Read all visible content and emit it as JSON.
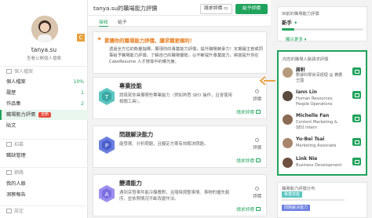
{
  "sidebar": {
    "username": "tanya.su",
    "public_view": "查看公開個人檔案",
    "sections": [
      {
        "label": "個人檔案"
      },
      {
        "label": "招募"
      },
      {
        "label": "網路"
      },
      {
        "label": "設定"
      }
    ],
    "items": [
      {
        "label": "個人檔案",
        "right": "10%"
      },
      {
        "label": "履歷",
        "right": "1"
      },
      {
        "label": "作品集",
        "right": "2"
      },
      {
        "label": "職場能力評價",
        "tag": "全新"
      },
      {
        "label": "貼文"
      },
      {
        "label": "職缺管理"
      },
      {
        "label": "我的人脈"
      },
      {
        "label": "洞察報告"
      }
    ]
  },
  "header": {
    "title": "tanya.su的職場能力評價",
    "request_btn": "請求評價",
    "self_eval_btn": "給予評價"
  },
  "tabs": [
    {
      "label": "接收"
    },
    {
      "label": "給予"
    }
  ],
  "info": {
    "heading": "累積你的職場能力評價，讓求職更順利！",
    "body": "透過全方位的衡量指標，展現你的專業能力評價，提升職場競爭力！定期讓主管或同事給予職場能力評價，了解自己的職場優勢，以不斷提升專業能力，將能提升你在 CakeResume 人才搜尋中的曝光度。"
  },
  "cards": [
    {
      "title": "專業技能",
      "desc": "請填寫你具備哪些專業能力（例如熟悉 SEO 操作，且會使用相關工具）。",
      "eval": "評價",
      "req": "請求評價"
    },
    {
      "title": "問題解決能力",
      "desc": "能發現、分析問題，且擬定方案有效解決問題。",
      "eval": "評價",
      "req": "請求評價"
    },
    {
      "title": "變通能力",
      "desc": "遇到突發事件能冷靜應對，且隨時調整事情、事物的優先順序，並依照情況不斷改變作法。",
      "eval": "評價",
      "req": "請求評價"
    }
  ],
  "level": {
    "label": "目前的職場能力評價",
    "value": "新手",
    "progress": 0.15,
    "more": "顯示更多"
  },
  "recommend": {
    "heading": "向您的職場人脈請求評價",
    "people": [
      {
        "name": "蔣軒",
        "role": "數據科學資深經理 @ 蒼鷹王國"
      },
      {
        "name": "Iann Lin",
        "role": "Human Resources, People Operations"
      },
      {
        "name": "Michelle Fan",
        "role": "Content Marketing & SEO Intern"
      },
      {
        "name": "Yu-Bei Tsai",
        "role": "Marketing Associate"
      },
      {
        "name": "Link Nie",
        "role": "Business Development"
      }
    ]
  },
  "dist": {
    "label": "職場能力評價分布",
    "tag1": "專業技能",
    "tag2": "問題解決能力"
  },
  "colors": {
    "accent": "#20a35c",
    "orange": "#e67e22",
    "new_tag": "#e74c3c"
  }
}
